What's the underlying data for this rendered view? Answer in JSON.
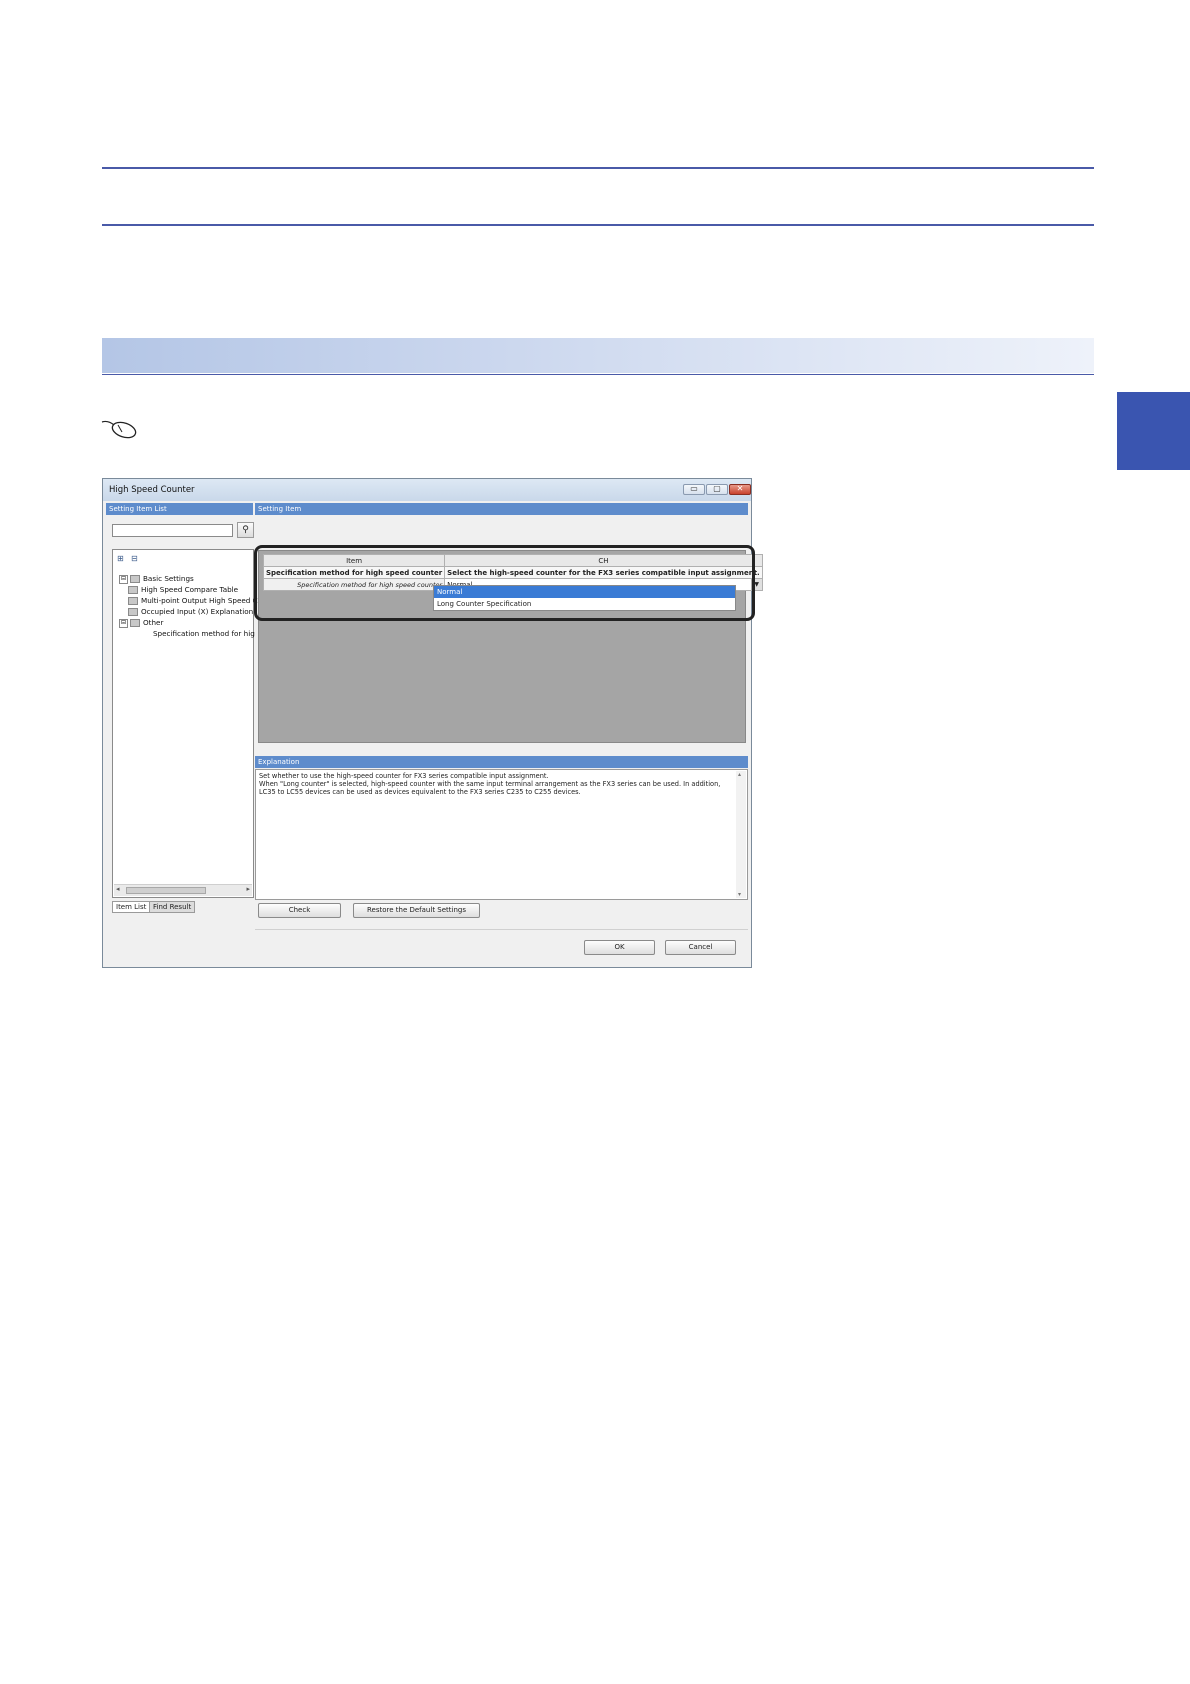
{
  "page": {
    "accent_color": "#3a55b0",
    "rule_color": "#4a5aa8",
    "icons": [
      "mouse-icon"
    ]
  },
  "window": {
    "title": "High Speed Counter",
    "title_buttons": {
      "minimize": "▭",
      "maximize": "▢",
      "close": "✕"
    },
    "left_pane_header": "Setting Item List",
    "right_pane_header": "Setting Item",
    "search_placeholder": "",
    "tree_tools": [
      "⊞",
      "⊟"
    ],
    "tree_items": [
      {
        "label": "Basic Settings",
        "expander": "⊟"
      },
      {
        "label": "High Speed Compare Table",
        "expander": ""
      },
      {
        "label": "Multi-point Output High Speed C",
        "expander": ""
      },
      {
        "label": "Occupied Input (X) Explanation",
        "expander": ""
      },
      {
        "label": "Other",
        "expander": "⊟"
      },
      {
        "label": "Specification method for hig",
        "expander": ""
      }
    ],
    "bottom_tabs": [
      "Item List",
      "Find Result"
    ],
    "grid": {
      "col_item": "Item",
      "col_ch": "CH",
      "row1_item": "Specification method for high speed counter",
      "row1_value": "Select the high-speed counter for the FX3 series compatible input assignment.",
      "row2_item": "Specification method for high speed counter",
      "row2_value": "Normal"
    },
    "dropdown_options": [
      {
        "label": "Normal",
        "selected": true
      },
      {
        "label": "Long Counter Specification",
        "selected": false
      }
    ],
    "explanation_header": "Explanation",
    "explanation_lines": [
      "Set whether to use the high-speed counter for FX3 series compatible input assignment.",
      "When \"Long counter\" is selected, high-speed counter with the same input terminal arrangement as the FX3 series can be used. In addition,",
      "LC35 to LC55 devices can be used as devices equivalent to the FX3 series C235 to C255 devices."
    ],
    "buttons": {
      "check": "Check",
      "restore": "Restore the Default Settings",
      "ok": "OK",
      "cancel": "Cancel"
    }
  }
}
